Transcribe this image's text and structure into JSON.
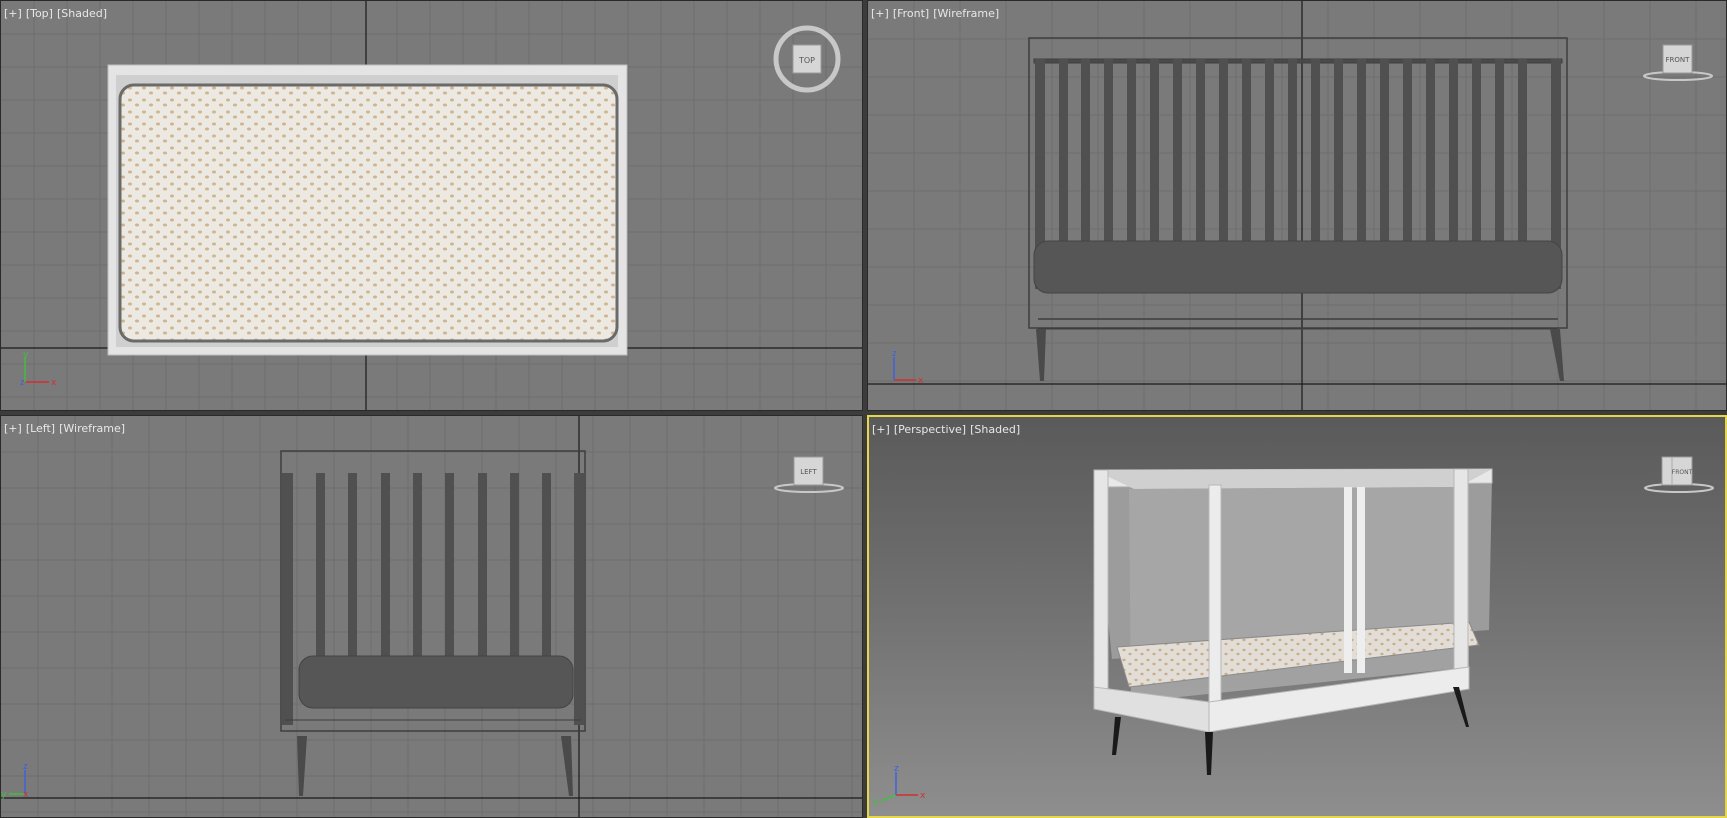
{
  "viewports": {
    "top": {
      "plus": "[+]",
      "view": "[Top]",
      "mode": "[Shaded]",
      "cube_label": "TOP"
    },
    "front": {
      "plus": "[+]",
      "view": "[Front]",
      "mode": "[Wireframe]",
      "cube_label": "FRONT"
    },
    "left": {
      "plus": "[+]",
      "view": "[Left]",
      "mode": "[Wireframe]",
      "cube_label": "LEFT"
    },
    "persp": {
      "plus": "[+]",
      "view": "[Perspective]",
      "mode": "[Shaded]",
      "cube_label": "FRONT"
    }
  },
  "axes": {
    "x": "x",
    "y": "y",
    "z": "z"
  },
  "colors": {
    "viewport_bg": "#7a7a7a",
    "active_border": "#e6d64a",
    "axis_x": "#d23030",
    "axis_y": "#40c040",
    "axis_z": "#4060e0"
  }
}
